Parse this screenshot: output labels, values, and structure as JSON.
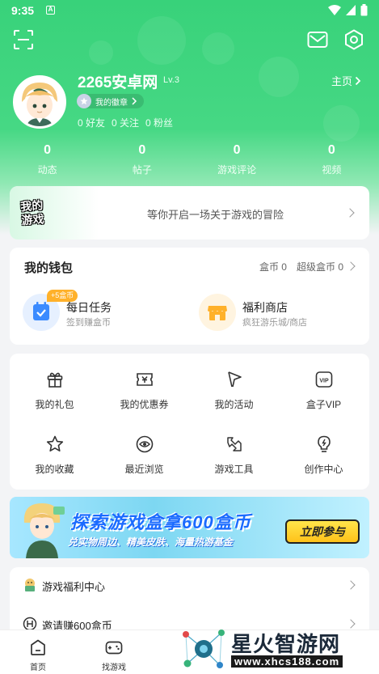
{
  "status_bar": {
    "time": "9:35",
    "notif_letter": "A"
  },
  "profile": {
    "username": "2265安卓网",
    "level": "Lv.3",
    "homepage_label": "主页",
    "badge_label": "我的徽章",
    "friends": "0 好友",
    "following": "0 关注",
    "followers": "0 粉丝"
  },
  "stats": [
    {
      "value": "0",
      "label": "动态"
    },
    {
      "value": "0",
      "label": "帖子"
    },
    {
      "value": "0",
      "label": "游戏评论"
    },
    {
      "value": "0",
      "label": "视频"
    }
  ],
  "adventure": {
    "logo_line1": "我的",
    "logo_line2": "游戏",
    "text": "等你开启一场关于游戏的冒险"
  },
  "wallet": {
    "title": "我的钱包",
    "box_coins": "盒币 0",
    "super_coins": "超级盒币 0",
    "daily_task": {
      "name": "每日任务",
      "sub": "签到赚盒币",
      "tag": "+5盒币"
    },
    "shop": {
      "name": "福利商店",
      "sub": "疯狂游乐城/商店"
    }
  },
  "grid": [
    {
      "label": "我的礼包",
      "icon": "gift-icon"
    },
    {
      "label": "我的优惠券",
      "icon": "coupon-icon"
    },
    {
      "label": "我的活动",
      "icon": "flag-icon"
    },
    {
      "label": "盒子VIP",
      "icon": "vip-icon"
    },
    {
      "label": "我的收藏",
      "icon": "star-icon"
    },
    {
      "label": "最近浏览",
      "icon": "eye-icon"
    },
    {
      "label": "游戏工具",
      "icon": "tools-icon"
    },
    {
      "label": "创作中心",
      "icon": "bulb-icon"
    }
  ],
  "banner": {
    "headline": "探索游戏盒拿600盒币",
    "subline": "兑实物周边、精美皮肤、海量热游基金",
    "cta": "立即参与"
  },
  "list": [
    {
      "label": "游戏福利中心",
      "icon": "welfare-icon"
    },
    {
      "label": "邀请赚600盒币",
      "icon": "invite-icon"
    }
  ],
  "tabbar": [
    {
      "label": "首页",
      "icon": "home-icon"
    },
    {
      "label": "找游戏",
      "icon": "gamepad-icon"
    }
  ],
  "watermark": {
    "title": "星火智游网",
    "url": "www.xhcs188.com"
  },
  "colors": {
    "brand_green": "#38d27a",
    "coin_orange": "#ffb12a",
    "task_blue": "#3b8bff",
    "banner_blue": "#1a6bff"
  }
}
